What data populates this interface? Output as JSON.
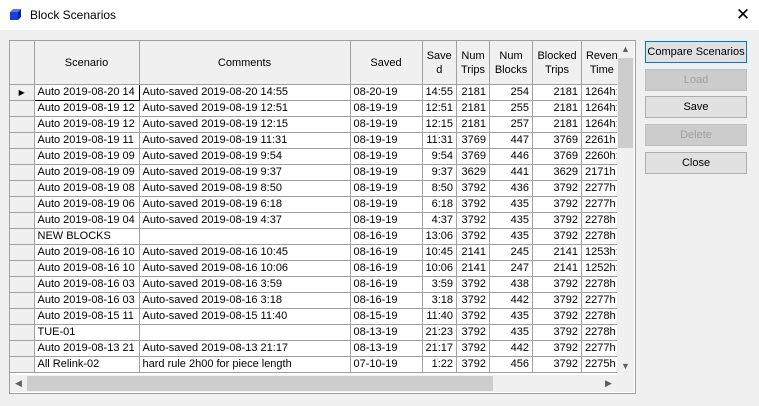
{
  "window": {
    "title": "Block Scenarios",
    "close_glyph": "✕",
    "icon": "blue-cube-icon"
  },
  "grid": {
    "columns": [
      "Scenario",
      "Comments",
      "Saved",
      "Saved",
      "Num Trips",
      "Num Blocks",
      "Blocked Trips",
      "Revenue Time"
    ],
    "column_header_text": [
      "Scenario",
      "Comments",
      "Saved",
      "Save d",
      "Num Trips",
      "Num Blocks",
      "Blocked Trips",
      "Reven Time"
    ],
    "rows": [
      {
        "scenario": "Auto 2019-08-20 14",
        "comments": "Auto-saved 2019-08-20 14:55",
        "saved": "08-20-19",
        "saved_time": "14:55",
        "num_trips": "2181",
        "num_blocks": "254",
        "blocked_trips": "2181",
        "revenue_time": "1264h:",
        "selected": true
      },
      {
        "scenario": "Auto 2019-08-19 12",
        "comments": "Auto-saved 2019-08-19 12:51",
        "saved": "08-19-19",
        "saved_time": "12:51",
        "num_trips": "2181",
        "num_blocks": "255",
        "blocked_trips": "2181",
        "revenue_time": "1264h:"
      },
      {
        "scenario": "Auto 2019-08-19 12",
        "comments": "Auto-saved 2019-08-19 12:15",
        "saved": "08-19-19",
        "saved_time": "12:15",
        "num_trips": "2181",
        "num_blocks": "257",
        "blocked_trips": "2181",
        "revenue_time": "1264h:"
      },
      {
        "scenario": "Auto 2019-08-19 11",
        "comments": "Auto-saved 2019-08-19 11:31",
        "saved": "08-19-19",
        "saved_time": "11:31",
        "num_trips": "3769",
        "num_blocks": "447",
        "blocked_trips": "3769",
        "revenue_time": "2261h"
      },
      {
        "scenario": "Auto 2019-08-19 09",
        "comments": "Auto-saved 2019-08-19  9:54",
        "saved": "08-19-19",
        "saved_time": "9:54",
        "num_trips": "3769",
        "num_blocks": "446",
        "blocked_trips": "3769",
        "revenue_time": "2260h:"
      },
      {
        "scenario": "Auto 2019-08-19 09",
        "comments": "Auto-saved 2019-08-19  9:37",
        "saved": "08-19-19",
        "saved_time": "9:37",
        "num_trips": "3629",
        "num_blocks": "441",
        "blocked_trips": "3629",
        "revenue_time": "2171h"
      },
      {
        "scenario": "Auto 2019-08-19 08",
        "comments": "Auto-saved 2019-08-19  8:50",
        "saved": "08-19-19",
        "saved_time": "8:50",
        "num_trips": "3792",
        "num_blocks": "436",
        "blocked_trips": "3792",
        "revenue_time": "2277h"
      },
      {
        "scenario": "Auto 2019-08-19 06",
        "comments": "Auto-saved 2019-08-19  6:18",
        "saved": "08-19-19",
        "saved_time": "6:18",
        "num_trips": "3792",
        "num_blocks": "435",
        "blocked_trips": "3792",
        "revenue_time": "2277h"
      },
      {
        "scenario": "Auto 2019-08-19 04",
        "comments": "Auto-saved 2019-08-19  4:37",
        "saved": "08-19-19",
        "saved_time": "4:37",
        "num_trips": "3792",
        "num_blocks": "435",
        "blocked_trips": "3792",
        "revenue_time": "2278h"
      },
      {
        "scenario": "NEW BLOCKS",
        "comments": "",
        "saved": "08-16-19",
        "saved_time": "13:06",
        "num_trips": "3792",
        "num_blocks": "435",
        "blocked_trips": "3792",
        "revenue_time": "2278h"
      },
      {
        "scenario": "Auto 2019-08-16 10",
        "comments": "Auto-saved 2019-08-16 10:45",
        "saved": "08-16-19",
        "saved_time": "10:45",
        "num_trips": "2141",
        "num_blocks": "245",
        "blocked_trips": "2141",
        "revenue_time": "1253h:"
      },
      {
        "scenario": "Auto 2019-08-16 10",
        "comments": "Auto-saved 2019-08-16 10:06",
        "saved": "08-16-19",
        "saved_time": "10:06",
        "num_trips": "2141",
        "num_blocks": "247",
        "blocked_trips": "2141",
        "revenue_time": "1252h:"
      },
      {
        "scenario": "Auto 2019-08-16 03",
        "comments": "Auto-saved 2019-08-16  3:59",
        "saved": "08-16-19",
        "saved_time": "3:59",
        "num_trips": "3792",
        "num_blocks": "438",
        "blocked_trips": "3792",
        "revenue_time": "2278h"
      },
      {
        "scenario": "Auto 2019-08-16 03",
        "comments": "Auto-saved 2019-08-16  3:18",
        "saved": "08-16-19",
        "saved_time": "3:18",
        "num_trips": "3792",
        "num_blocks": "442",
        "blocked_trips": "3792",
        "revenue_time": "2277h"
      },
      {
        "scenario": "Auto 2019-08-15 11",
        "comments": "Auto-saved 2019-08-15 11:40",
        "saved": "08-15-19",
        "saved_time": "11:40",
        "num_trips": "3792",
        "num_blocks": "435",
        "blocked_trips": "3792",
        "revenue_time": "2278h"
      },
      {
        "scenario": "TUE-01",
        "comments": "",
        "saved": "08-13-19",
        "saved_time": "21:23",
        "num_trips": "3792",
        "num_blocks": "435",
        "blocked_trips": "3792",
        "revenue_time": "2278h"
      },
      {
        "scenario": "Auto 2019-08-13 21",
        "comments": "Auto-saved 2019-08-13 21:17",
        "saved": "08-13-19",
        "saved_time": "21:17",
        "num_trips": "3792",
        "num_blocks": "442",
        "blocked_trips": "3792",
        "revenue_time": "2277h"
      },
      {
        "scenario": "All Relink-02",
        "comments": "hard rule 2h00 for piece length",
        "saved": "07-10-19",
        "saved_time": "1:22",
        "num_trips": "3792",
        "num_blocks": "456",
        "blocked_trips": "3792",
        "revenue_time": "2275h"
      }
    ]
  },
  "buttons": {
    "compare": "Compare Scenarios",
    "load": "Load",
    "save": "Save",
    "delete": "Delete",
    "close": "Close"
  },
  "icons": {
    "row_selected": "row-pointer-icon",
    "scroll_up": "chevron-up-icon",
    "scroll_down": "chevron-down-icon",
    "scroll_left": "chevron-left-icon",
    "scroll_right": "chevron-right-icon"
  }
}
